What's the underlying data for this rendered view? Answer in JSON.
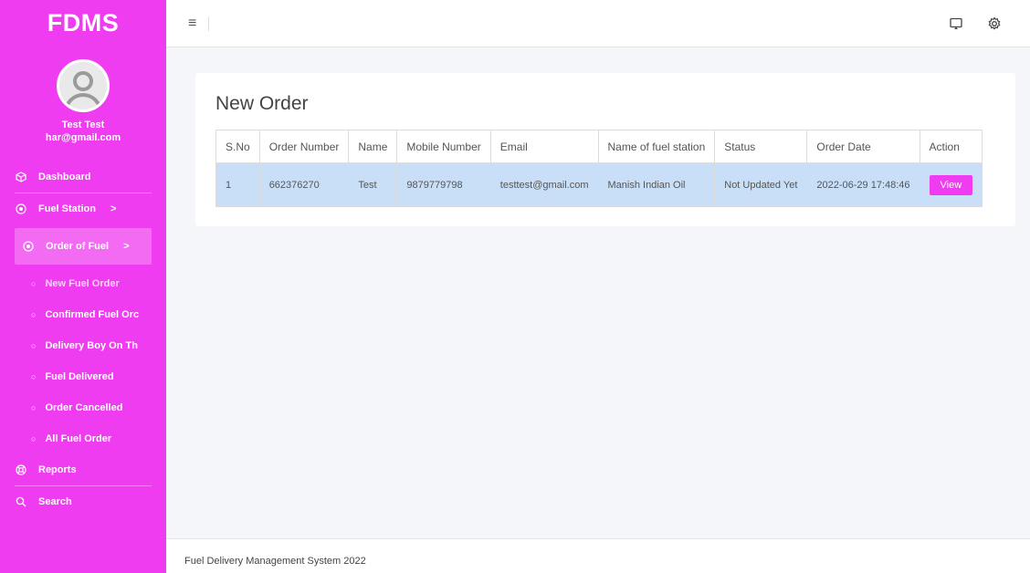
{
  "brand": "FDMS",
  "user": {
    "name": "Test Test",
    "email": "har@gmail.com"
  },
  "sidebar": {
    "items": [
      {
        "label": "Dashboard",
        "icon": "cube-icon"
      },
      {
        "label": "Fuel Station",
        "icon": "target-icon",
        "arrow": ">"
      },
      {
        "label": "Order of Fuel",
        "icon": "target-icon",
        "arrow": ">"
      }
    ],
    "subitems": [
      "New Fuel Order",
      "Confirmed Fuel Orc",
      "Delivery Boy On Th",
      "Fuel Delivered",
      "Order Cancelled",
      "All Fuel Order"
    ],
    "bottom": [
      {
        "label": "Reports",
        "icon": "lifebuoy-icon"
      },
      {
        "label": "Search",
        "icon": "search-icon"
      }
    ]
  },
  "topbar": {
    "menu_icon": "hamburger-icon",
    "icons": [
      "cast-icon",
      "gear-icon"
    ]
  },
  "main": {
    "title": "New Order",
    "table": {
      "headers": [
        "S.No",
        "Order Number",
        "Name",
        "Mobile Number",
        "Email",
        "Name of fuel station",
        "Status",
        "Order Date",
        "Action"
      ],
      "rows": [
        [
          "1",
          "662376270",
          "Test",
          "9879779798",
          "testtest@gmail.com",
          "Manish Indian Oil",
          "Not Updated Yet",
          "2022-06-29 17:48:46",
          "View"
        ]
      ]
    }
  },
  "footer": "Fuel Delivery Management System 2022",
  "colors": {
    "accent": "#f03cf0",
    "row_highlight": "#c9dff8"
  }
}
